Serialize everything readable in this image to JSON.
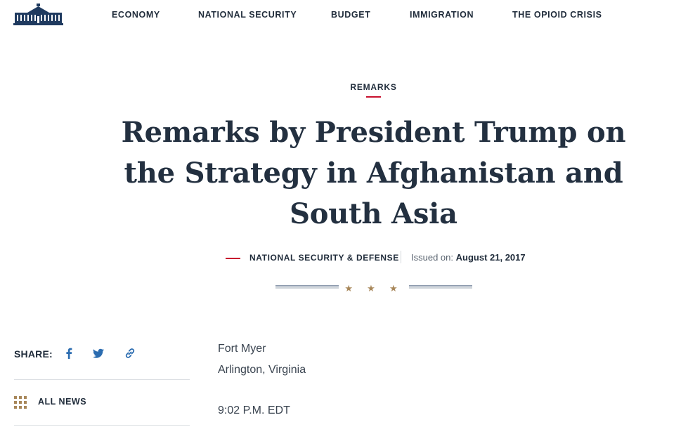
{
  "nav": {
    "items": [
      {
        "label": "ECONOMY"
      },
      {
        "label": "NATIONAL SECURITY"
      },
      {
        "label": "BUDGET"
      },
      {
        "label": "IMMIGRATION"
      },
      {
        "label": "THE OPIOID CRISIS"
      }
    ]
  },
  "article": {
    "eyebrow": "REMARKS",
    "title": "Remarks by President Trump on the Strategy in Afghanistan and South Asia",
    "category": "NATIONAL SECURITY & DEFENSE",
    "issued_label": "Issued on:",
    "issued_date": "August 21, 2017",
    "stars": "★ ★ ★",
    "location_line1": "Fort Myer",
    "location_line2": "Arlington, Virginia",
    "time": "9:02 P.M. EDT"
  },
  "sidebar": {
    "share_label": "SHARE:",
    "share_icons": [
      "facebook-icon",
      "twitter-icon",
      "link-icon"
    ],
    "all_news_label": "ALL NEWS"
  },
  "colors": {
    "accent_red": "#c8102e",
    "navy": "#1f2b3a",
    "gold": "#a8875a",
    "share_blue": "#2b6cb0"
  }
}
